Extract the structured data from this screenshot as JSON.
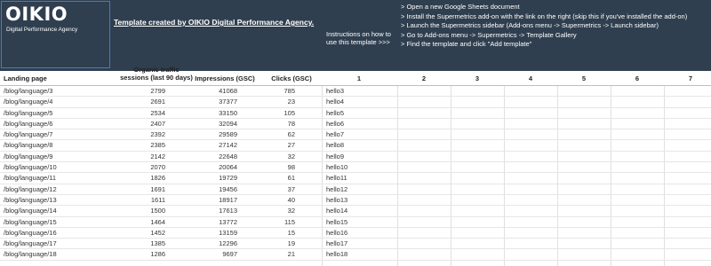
{
  "banner": {
    "logo_text": "OIKIO",
    "logo_subtitle": "Digital Performance Agency",
    "template_credit": "Template created by OIKIO Digital Performance Agency.",
    "instructions_label_line1": "Instructions on how to",
    "instructions_label_line2": "use this template  >>>",
    "instructions": [
      "> Open a new Google Sheets document",
      "> Install the Supermetrics add-on with the link on the right (skip this if you've installed the add-on)",
      "> Launch the Supermetrics sidebar (Add-ons menu -> Supermetrics -> Launch sidebar)",
      "> Go to Add-ons menu -> Supermetrics -> Template Gallery",
      "> Find the template and click \"Add template\""
    ]
  },
  "columns": {
    "landing_page": "Landing page",
    "organic_line1": "Organic traffic",
    "organic_line2": "sessions (last 90 days)",
    "impressions": "Impressions (GSC)",
    "clicks": "Clicks (GSC)",
    "numbered": [
      "1",
      "2",
      "3",
      "4",
      "5",
      "6",
      "7"
    ]
  },
  "rows": [
    {
      "landing": "/blog/language/3",
      "organic": "2799",
      "impressions": "41068",
      "clicks": "785",
      "c1": "hello3"
    },
    {
      "landing": "/blog/language/4",
      "organic": "2691",
      "impressions": "37377",
      "clicks": "23",
      "c1": "hello4"
    },
    {
      "landing": "/blog/language/5",
      "organic": "2534",
      "impressions": "33150",
      "clicks": "105",
      "c1": "hello5"
    },
    {
      "landing": "/blog/language/6",
      "organic": "2407",
      "impressions": "32094",
      "clicks": "78",
      "c1": "hello6"
    },
    {
      "landing": "/blog/language/7",
      "organic": "2392",
      "impressions": "29589",
      "clicks": "62",
      "c1": "hello7"
    },
    {
      "landing": "/blog/language/8",
      "organic": "2385",
      "impressions": "27142",
      "clicks": "27",
      "c1": "hello8"
    },
    {
      "landing": "/blog/language/9",
      "organic": "2142",
      "impressions": "22648",
      "clicks": "32",
      "c1": "hello9"
    },
    {
      "landing": "/blog/language/10",
      "organic": "2070",
      "impressions": "20064",
      "clicks": "98",
      "c1": "hello10"
    },
    {
      "landing": "/blog/language/11",
      "organic": "1826",
      "impressions": "19729",
      "clicks": "61",
      "c1": "hello11"
    },
    {
      "landing": "/blog/language/12",
      "organic": "1691",
      "impressions": "19456",
      "clicks": "37",
      "c1": "hello12"
    },
    {
      "landing": "/blog/language/13",
      "organic": "1611",
      "impressions": "18917",
      "clicks": "40",
      "c1": "hello13"
    },
    {
      "landing": "/blog/language/14",
      "organic": "1500",
      "impressions": "17613",
      "clicks": "32",
      "c1": "hello14"
    },
    {
      "landing": "/blog/language/15",
      "organic": "1464",
      "impressions": "13772",
      "clicks": "115",
      "c1": "hello15"
    },
    {
      "landing": "/blog/language/16",
      "organic": "1452",
      "impressions": "13159",
      "clicks": "15",
      "c1": "hello16"
    },
    {
      "landing": "/blog/language/17",
      "organic": "1385",
      "impressions": "12296",
      "clicks": "19",
      "c1": "hello17"
    },
    {
      "landing": "/blog/language/18",
      "organic": "1286",
      "impressions": "9697",
      "clicks": "21",
      "c1": "hello18"
    }
  ],
  "colors": {
    "banner_bg": "#2f3f4f",
    "logo_border": "#4a78c8"
  }
}
